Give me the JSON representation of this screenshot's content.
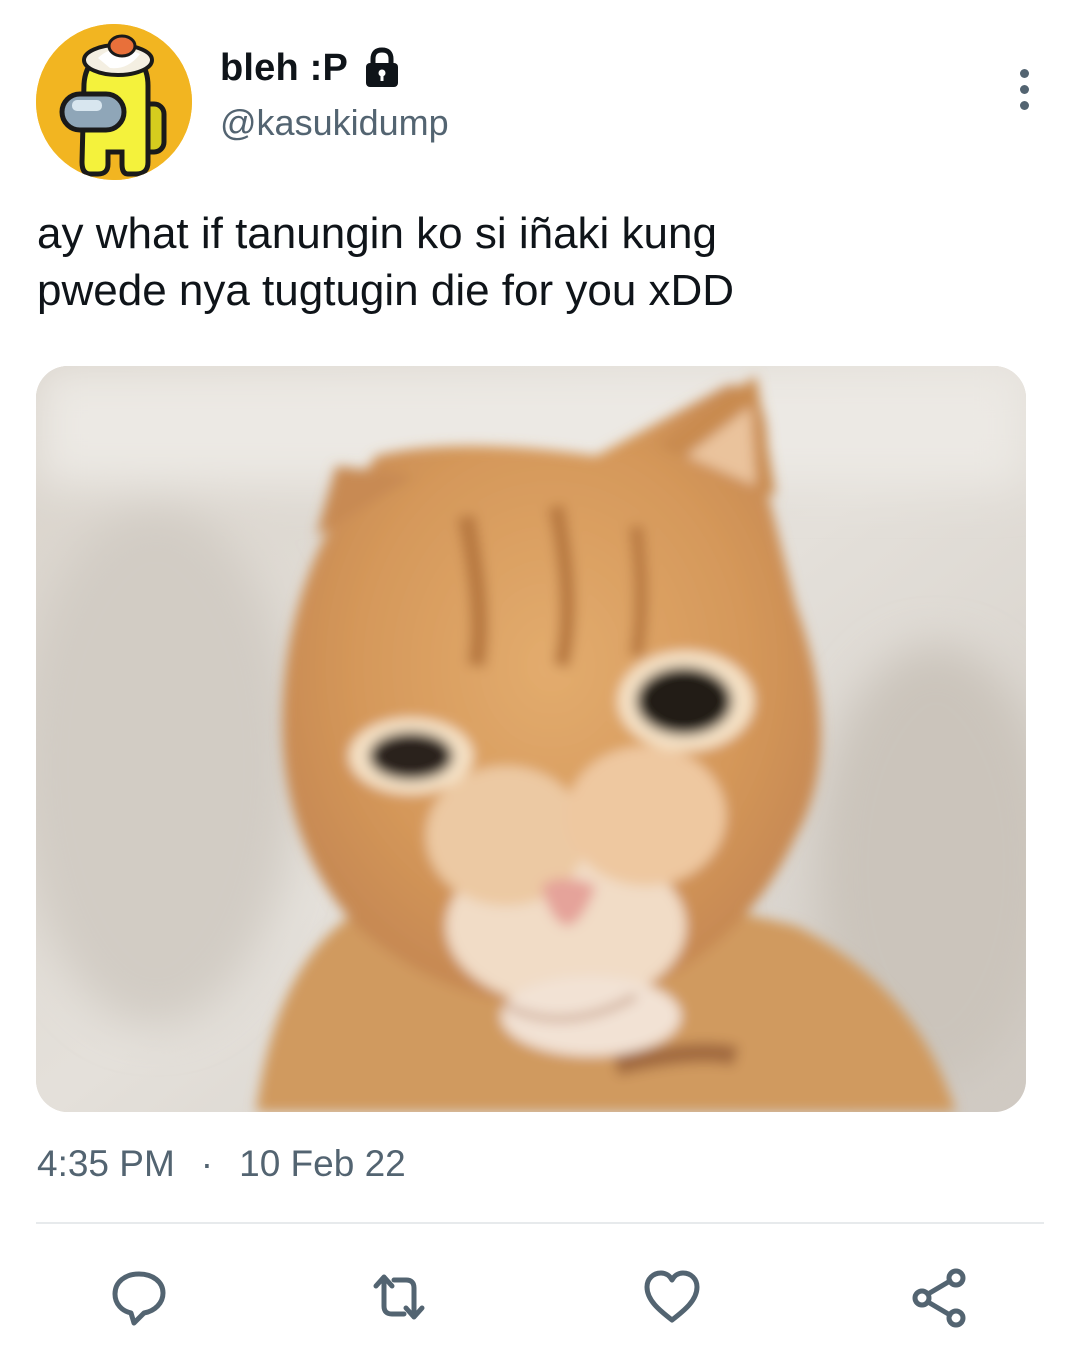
{
  "tweet": {
    "author": {
      "display_name": "bleh :P",
      "handle": "@kasukidump",
      "protected_icon": "lock-icon",
      "avatar": "among-us-yellow-crewmate-with-egg-hat"
    },
    "text": "ay what if tanungin ko si iñaki kung\npwede nya tugtugin die for you xDD",
    "media": {
      "type": "photo",
      "subject": "orange-tabby-cat"
    },
    "time": "4:35 PM",
    "separator": "·",
    "date": "10 Feb 22",
    "actions": [
      {
        "name": "reply",
        "icon": "reply-icon"
      },
      {
        "name": "retweet",
        "icon": "retweet-icon"
      },
      {
        "name": "like",
        "icon": "heart-icon"
      },
      {
        "name": "share",
        "icon": "share-icon"
      }
    ]
  },
  "colors": {
    "text_primary": "#0f1419",
    "text_secondary": "#536471",
    "icon": "#536471",
    "divider": "#e7eaec",
    "background": "#ffffff"
  }
}
